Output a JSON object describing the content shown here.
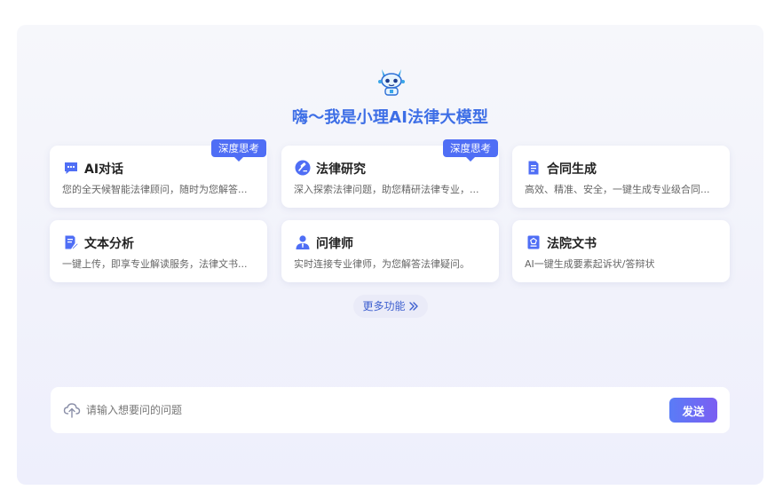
{
  "header": {
    "title": "嗨～我是小理AI法律大模型"
  },
  "cards": [
    {
      "title": "AI对话",
      "desc": "您的全天候智能法律顾问，随时为您解答...",
      "badge": "深度思考",
      "icon": "chat-icon"
    },
    {
      "title": "法律研究",
      "desc": "深入探索法律问题，助您精研法律专业，...",
      "badge": "深度思考",
      "icon": "gavel-icon"
    },
    {
      "title": "合同生成",
      "desc": "高效、精准、安全，一键生成专业级合同...",
      "icon": "contract-icon"
    },
    {
      "title": "文本分析",
      "desc": "一键上传，即享专业解读服务，法律文书...",
      "icon": "document-edit-icon"
    },
    {
      "title": "问律师",
      "desc": "实时连接专业律师，为您解答法律疑问。",
      "icon": "lawyer-icon"
    },
    {
      "title": "法院文书",
      "desc": "AI一键生成要素起诉状/答辩状",
      "icon": "court-document-icon"
    }
  ],
  "more": {
    "label": "更多功能"
  },
  "input": {
    "placeholder": "请输入想要问的问题",
    "value": "",
    "send_label": "发送"
  },
  "colors": {
    "accent": "#4f6ef5",
    "title": "#3d6ee6",
    "send_gradient_start": "#5a7cf7",
    "send_gradient_end": "#7b5ef2"
  }
}
